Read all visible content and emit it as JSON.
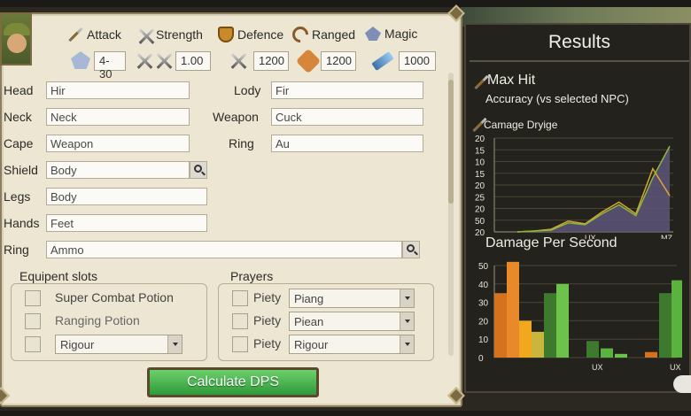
{
  "stats": {
    "attack": "Attack",
    "strength": "Strength",
    "defence": "Defence",
    "ranged": "Ranged",
    "magic": "Magic",
    "val1": "4-30",
    "val2": "1.00",
    "val3": "1200",
    "val4": "1200",
    "val5": "1000"
  },
  "equipment": {
    "head_label": "Head",
    "head_value": "Hir",
    "neck_label": "Neck",
    "neck_value": "Neck",
    "cape_label": "Cape",
    "cape_value": "Weapon",
    "shield_label": "Shield",
    "shield_value": "Body",
    "legs_label": "Legs",
    "legs_value": "Body",
    "hands_label": "Hands",
    "hands_value": "Feet",
    "ring_label": "Ring",
    "ring_value": "Ammo",
    "lody_label": "Lody",
    "lody_value": "Fir",
    "weapon_label": "Weapon",
    "weapon_value": "Cuck",
    "ring2_label": "Ring",
    "ring2_value": "Au"
  },
  "slots": {
    "title": "Equipent slots",
    "opt1": "Super Combat Potion",
    "opt2": "Ranging Potion",
    "select": "Rigour"
  },
  "prayers": {
    "title": "Prayers",
    "rows": [
      {
        "label": "Piety",
        "select": "Piang"
      },
      {
        "label": "Piety",
        "select": "Piean"
      },
      {
        "label": "Piety",
        "select": "Rigour"
      }
    ]
  },
  "calculate_label": "Calculate DPS",
  "results": {
    "title": "Results",
    "max_hit": "Max Hit",
    "accuracy": "Accuracy (vs selected NPC)",
    "damage_label": "Camage Dryige",
    "dps_title": "Damage Per Second"
  },
  "colors": {
    "accent_green": "#3aa544",
    "panel_bg": "#ece6d3",
    "results_bg": "#24221c"
  },
  "chart_data": [
    {
      "type": "area",
      "title": "Camage Dryige",
      "yticks": [
        20,
        15,
        10,
        15,
        20,
        25,
        20,
        50,
        20
      ],
      "xticks": [
        "UX",
        "MZ"
      ],
      "series": [
        {
          "values": [
            0,
            1,
            2,
            10,
            8,
            20,
            30,
            18,
            60,
            95
          ]
        },
        {
          "values": [
            0,
            1,
            3,
            12,
            9,
            22,
            33,
            20,
            70,
            40
          ]
        }
      ]
    },
    {
      "type": "bar",
      "title": "Damage Per Second",
      "yticks": [
        50,
        40,
        30,
        20,
        10,
        0
      ],
      "xticks": [
        "UX",
        "UX"
      ],
      "values": [
        35,
        52,
        20,
        14,
        35,
        40,
        9,
        5,
        2,
        3,
        35,
        42
      ]
    }
  ]
}
